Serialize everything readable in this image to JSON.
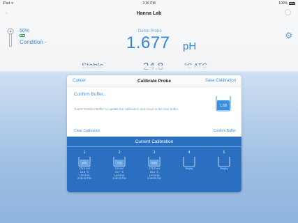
{
  "status_bar": {
    "carrier": "iPad ᯤ",
    "time": "3:36 PM",
    "battery": "100%"
  },
  "nav": {
    "title": "Hanna Lab"
  },
  "probe_panel": {
    "battery_pct": "50%",
    "condition": "Condition -",
    "probe_name": "Demo Probe",
    "ph_value": "1.677",
    "ph_unit": "pH",
    "stability": "Stable",
    "temperature": "24.8",
    "temp_unit": "°C ATC"
  },
  "calibration_popover": {
    "cancel_label": "Cancel",
    "title": "Calibrate Probe",
    "save_label": "Save Calibration",
    "confirm_label": "Confirm Buffer...",
    "hint": "Touch 'Confirm Buffer' to update the calibration and move to the next buffer.",
    "beaker_value": "1.68",
    "clear_label": "Clear Calibration",
    "confirm_button_label": "Confirm Buffer",
    "current_title": "Current Calibration",
    "slots": [
      {
        "num": "1",
        "buffer": "4.01",
        "mv": "178.5 mV",
        "temp": "24.8 °C",
        "date": "10/13/15",
        "time": "2:06:22 PM"
      },
      {
        "num": "2",
        "buffer": "7.01",
        "mv": "0.0 mV",
        "temp": "24.7 °C",
        "date": "10/13/15",
        "time": "2:06:22 PM"
      },
      {
        "num": "3",
        "buffer": "10.01",
        "mv": "-176.5 mV",
        "temp": "25.0 °C",
        "date": "10/13/15",
        "time": "2:06:22 PM"
      },
      {
        "num": "4",
        "buffer": "",
        "empty": "Empty"
      },
      {
        "num": "5",
        "buffer": "",
        "empty": "Empty"
      }
    ]
  },
  "colors": {
    "accent": "#2f86dc",
    "panel": "#2a6fc0",
    "backdrop": "#9fc0e3"
  }
}
